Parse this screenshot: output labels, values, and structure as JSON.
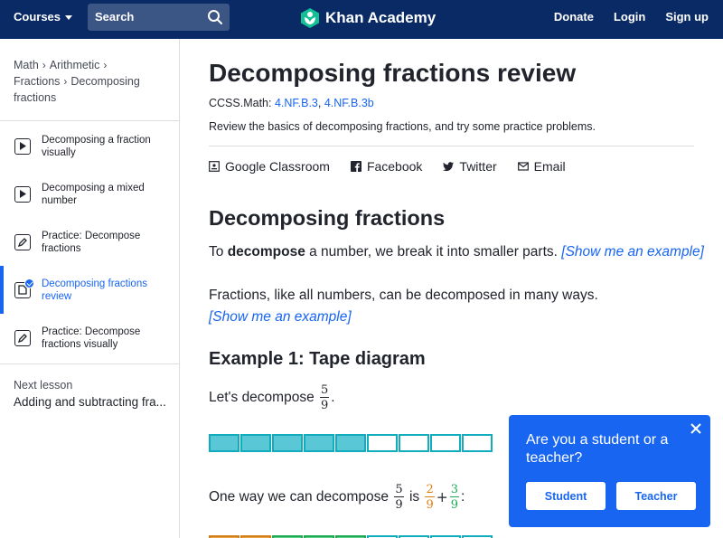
{
  "header": {
    "courses_label": "Courses",
    "search_label": "Search",
    "logo_text": "Khan Academy",
    "nav": [
      "Donate",
      "Login",
      "Sign up"
    ]
  },
  "sidebar": {
    "breadcrumbs": [
      "Math",
      "Arithmetic",
      "Fractions",
      "Decomposing fractions"
    ],
    "items": [
      {
        "label": "Decomposing a fraction visually",
        "icon": "play-icon"
      },
      {
        "label": "Decomposing a mixed number",
        "icon": "play-icon"
      },
      {
        "label": "Practice: Decompose fractions",
        "icon": "pencil-icon"
      },
      {
        "label": "Decomposing fractions review",
        "icon": "article-icon",
        "active": true
      },
      {
        "label": "Practice: Decompose fractions visually",
        "icon": "pencil-icon"
      }
    ],
    "next_label": "Next lesson",
    "next_title": "Adding and subtracting fra..."
  },
  "main": {
    "title": "Decomposing fractions review",
    "ccss_prefix": "CCSS.Math: ",
    "ccss_links": [
      "4.NF.B.3",
      "4.NF.B.3b"
    ],
    "ccss_sep": ", ",
    "description": "Review the basics of decomposing fractions, and try some practice problems.",
    "share": [
      "Google Classroom",
      "Facebook",
      "Twitter",
      "Email"
    ],
    "section_title": "Decomposing fractions",
    "p1_before": "To ",
    "p1_bold": "decompose",
    "p1_after": " a number, we break it into smaller parts. ",
    "show_example": "[Show me an example]",
    "p2": "Fractions, like all numbers, can be decomposed in many ways.",
    "example_title": "Example 1: Tape diagram",
    "lets_decompose": "Let's decompose",
    "frac_main": {
      "num": "5",
      "den": "9"
    },
    "tape1": {
      "filled": 5,
      "total": 9
    },
    "one_way": "One way we can decompose",
    "is": "is",
    "frac_a": {
      "num": "2",
      "den": "9"
    },
    "frac_b": {
      "num": "3",
      "den": "9"
    },
    "plus": "+",
    "period": ".",
    "colon": ":"
  },
  "popup": {
    "title": "Are you a student or a teacher?",
    "student": "Student",
    "teacher": "Teacher"
  },
  "colors": {
    "header_bg": "#0a2a66",
    "accent": "#1865f2",
    "tape_fill": "#59c7d6",
    "orange": "#e07d10",
    "green": "#1fab54"
  }
}
